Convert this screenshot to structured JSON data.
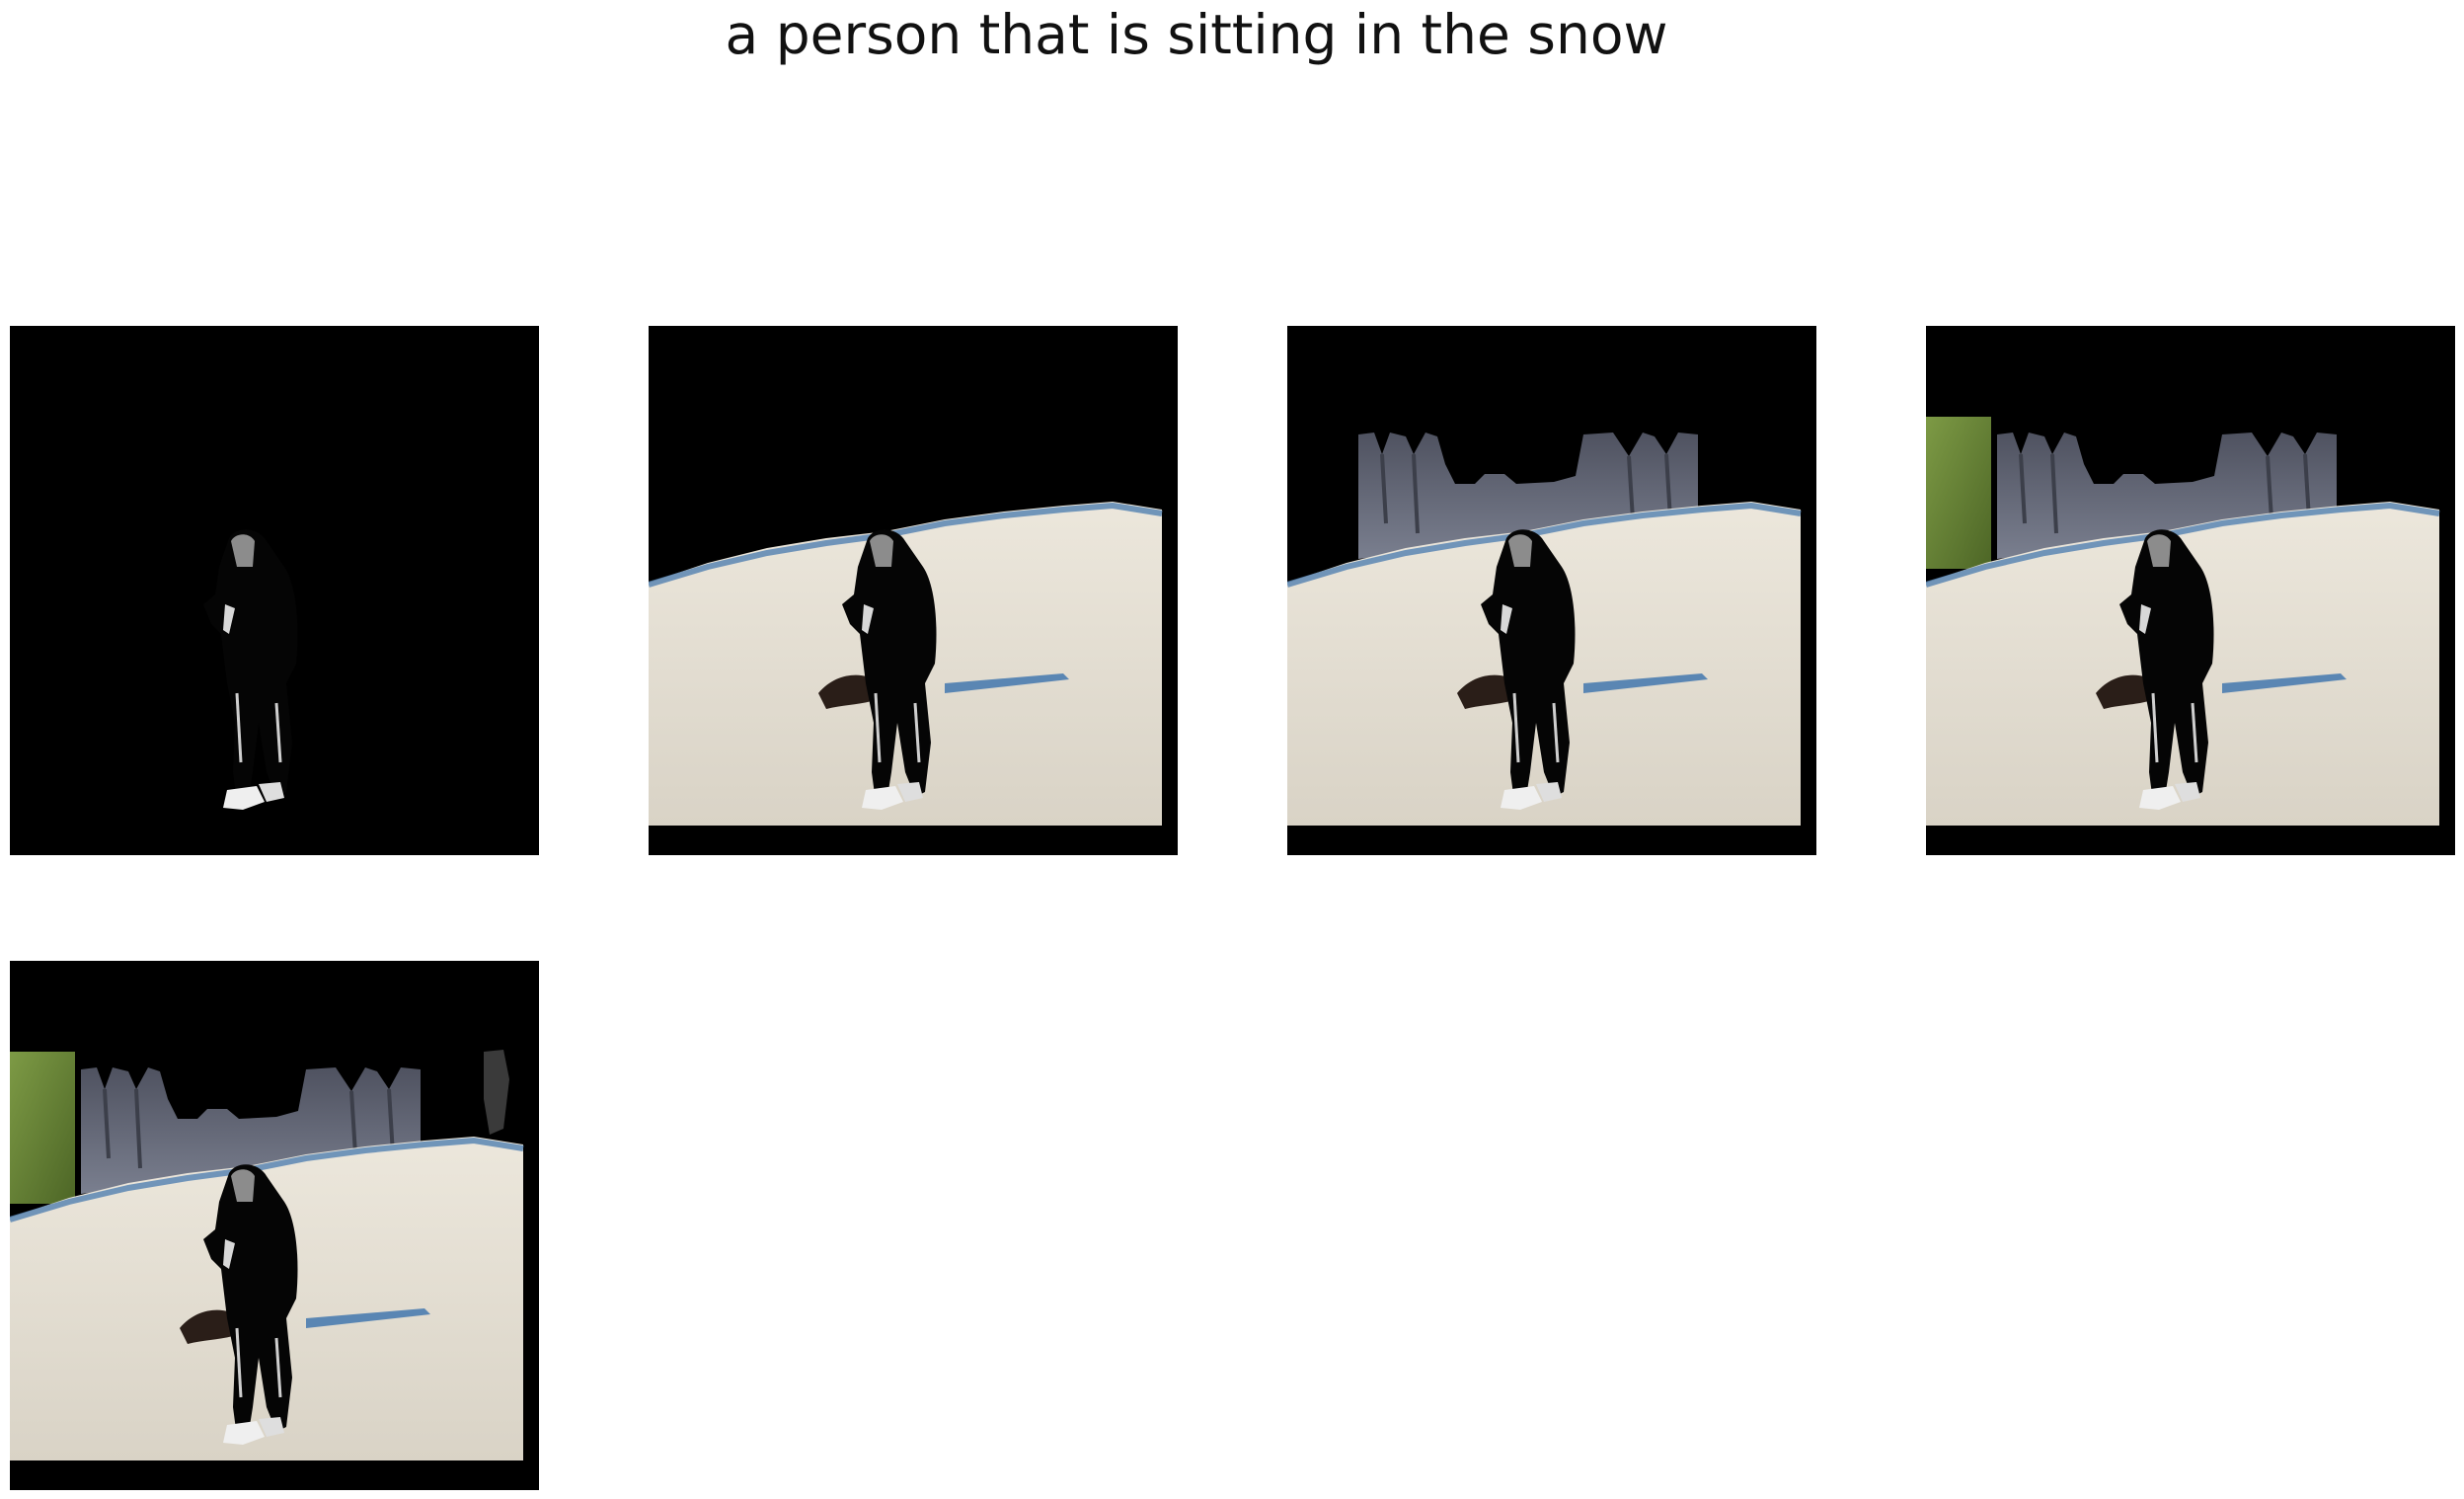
{
  "caption": "a person that is sitting in the snow",
  "panels": [
    {
      "layers": [
        "person"
      ]
    },
    {
      "layers": [
        "person",
        "snow"
      ]
    },
    {
      "layers": [
        "person",
        "snow",
        "trees"
      ]
    },
    {
      "layers": [
        "person",
        "snow",
        "trees",
        "grass"
      ]
    },
    {
      "layers": [
        "person",
        "snow",
        "trees",
        "grass",
        "tree-edge"
      ]
    }
  ],
  "colors": {
    "background": "#000000",
    "snow": "#e6e1d6",
    "trees": "#5b5e6a",
    "grass": "#6f8a3c",
    "shadow": "#5a86b3",
    "person": "#050505"
  }
}
